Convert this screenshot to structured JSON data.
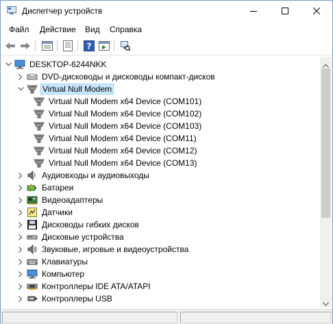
{
  "window": {
    "title": "Диспетчер устройств"
  },
  "menu": [
    "Файл",
    "Действие",
    "Вид",
    "Справка"
  ],
  "toolbar": {
    "icons": [
      "back-icon",
      "forward-icon",
      "properties-icon",
      "console-tree-icon",
      "help-icon",
      "update-driver-icon",
      "scan-hardware-icon"
    ]
  },
  "tree": {
    "root": "DESKTOP-6244NKK",
    "items": [
      {
        "label": "DVD-дисководы и дисководы компакт-дисков",
        "icon": "dvd-icon",
        "level": 1,
        "state": "collapsed"
      },
      {
        "label": "Virtual Null Modem",
        "icon": "modem-icon",
        "level": 1,
        "state": "expanded",
        "selected": true
      },
      {
        "label": "Virtual Null Modem x64 Device (COM101)",
        "icon": "modem-icon",
        "level": 2
      },
      {
        "label": "Virtual Null Modem x64 Device (COM102)",
        "icon": "modem-icon",
        "level": 2
      },
      {
        "label": "Virtual Null Modem x64 Device (COM103)",
        "icon": "modem-icon",
        "level": 2
      },
      {
        "label": "Virtual Null Modem x64 Device (COM11)",
        "icon": "modem-icon",
        "level": 2
      },
      {
        "label": "Virtual Null Modem x64 Device (COM12)",
        "icon": "modem-icon",
        "level": 2
      },
      {
        "label": "Virtual Null Modem x64 Device (COM13)",
        "icon": "modem-icon",
        "level": 2
      },
      {
        "label": "Аудиовходы и аудиовыходы",
        "icon": "speaker-icon",
        "level": 1,
        "state": "collapsed"
      },
      {
        "label": "Батареи",
        "icon": "battery-icon",
        "level": 1,
        "state": "collapsed"
      },
      {
        "label": "Видеоадаптеры",
        "icon": "display-adapter-icon",
        "level": 1,
        "state": "collapsed"
      },
      {
        "label": "Датчики",
        "icon": "sensor-icon",
        "level": 1,
        "state": "collapsed"
      },
      {
        "label": "Дисководы гибких дисков",
        "icon": "floppy-drive-icon",
        "level": 1,
        "state": "collapsed"
      },
      {
        "label": "Дисковые устройства",
        "icon": "disk-drive-icon",
        "level": 1,
        "state": "collapsed"
      },
      {
        "label": "Звуковые, игровые и видеоустройства",
        "icon": "sound-icon",
        "level": 1,
        "state": "collapsed"
      },
      {
        "label": "Клавиатуры",
        "icon": "keyboard-icon",
        "level": 1,
        "state": "collapsed"
      },
      {
        "label": "Компьютер",
        "icon": "computer-icon",
        "level": 1,
        "state": "collapsed"
      },
      {
        "label": "Контроллеры IDE ATA/ATAPI",
        "icon": "ide-controller-icon",
        "level": 1,
        "state": "collapsed"
      },
      {
        "label": "Контроллеры USB",
        "icon": "usb-controller-icon",
        "level": 1,
        "state": "collapsed"
      }
    ]
  }
}
